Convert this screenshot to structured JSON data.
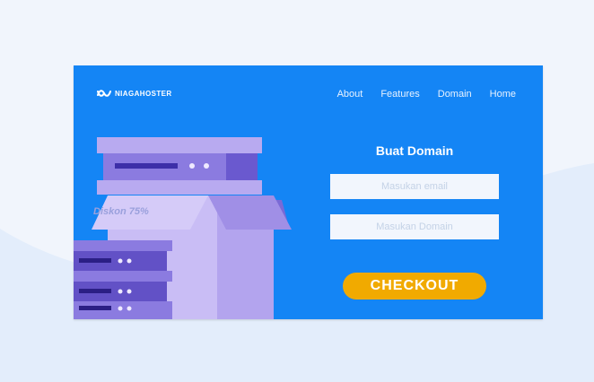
{
  "brand": {
    "name": "NIAGAHOSTER"
  },
  "nav": {
    "items": [
      "About",
      "Features",
      "Domain",
      "Home"
    ]
  },
  "illustration": {
    "discount_label": "Diskon 75%"
  },
  "form": {
    "title": "Buat Domain",
    "email_placeholder": "Masukan email",
    "domain_placeholder": "Masukan Domain",
    "email_value": "",
    "domain_value": "",
    "checkout_label": "CHECKOUT"
  },
  "colors": {
    "primary_blue": "#1485f5",
    "cta_yellow": "#f1aa00",
    "server_purple": "#a597e8",
    "page_background": "#f1f5fc"
  }
}
